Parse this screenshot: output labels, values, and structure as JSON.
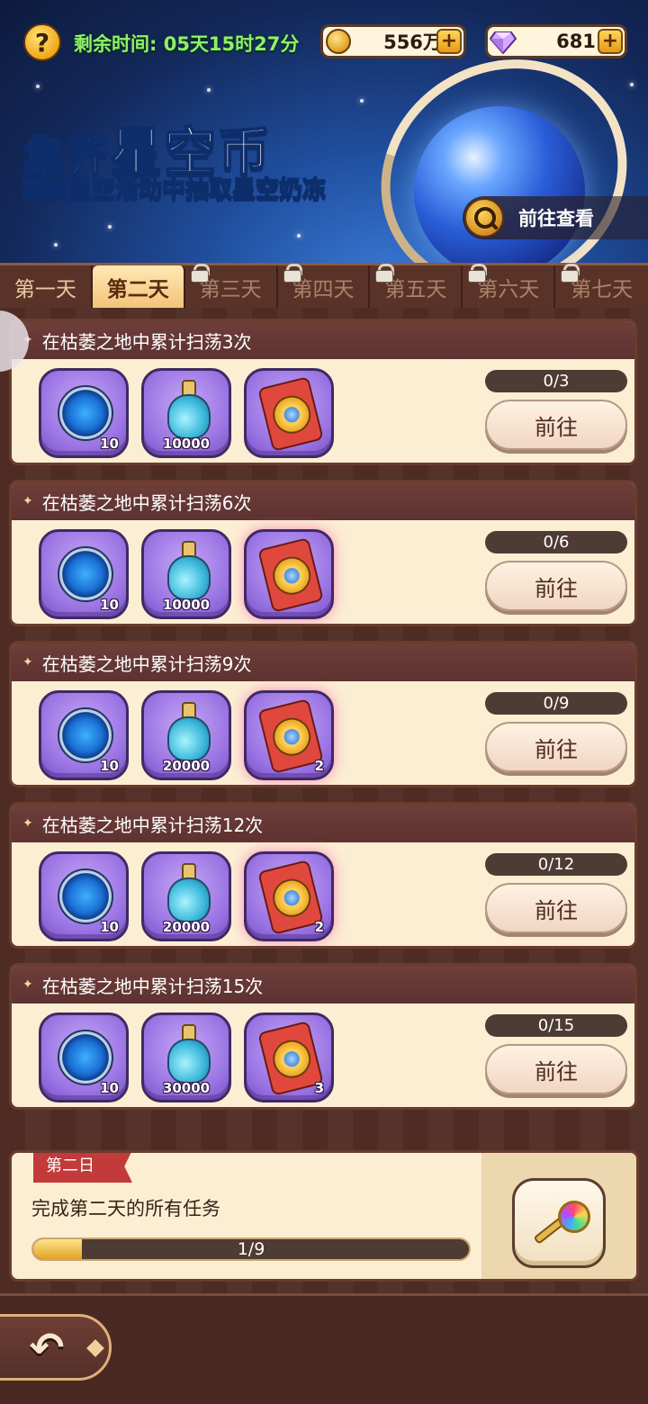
{
  "header": {
    "help_symbol": "?",
    "timer": "剩余时间: 05天15时27分",
    "gold": {
      "value": "556万",
      "icon": "gold-coin-icon"
    },
    "gems": {
      "value": "681",
      "icon": "diamond-icon"
    },
    "plus": "+"
  },
  "banner": {
    "title_prefix": "集齐",
    "title_main": "星空币",
    "subtitle_prefix": "寒夜星空活动中抽取",
    "subtitle_highlight": "星空奶冻",
    "view_button": "前往查看"
  },
  "tabs": [
    {
      "label": "第一天",
      "locked": false
    },
    {
      "label": "第二天",
      "locked": false,
      "active": true
    },
    {
      "label": "第三天",
      "locked": true
    },
    {
      "label": "第四天",
      "locked": true
    },
    {
      "label": "第五天",
      "locked": true
    },
    {
      "label": "第六天",
      "locked": true
    },
    {
      "label": "第七天",
      "locked": true
    }
  ],
  "tasks": [
    {
      "title": "在枯萎之地中累计扫荡3次",
      "progress": "0/3",
      "button": "前往",
      "rewards": [
        {
          "type": "star-coin",
          "qty": "10"
        },
        {
          "type": "potion",
          "qty": "10000"
        },
        {
          "type": "ticket",
          "qty": ""
        }
      ]
    },
    {
      "title": "在枯萎之地中累计扫荡6次",
      "progress": "0/6",
      "button": "前往",
      "rewards": [
        {
          "type": "star-coin",
          "qty": "10"
        },
        {
          "type": "potion",
          "qty": "10000"
        },
        {
          "type": "ticket",
          "qty": ""
        }
      ]
    },
    {
      "title": "在枯萎之地中累计扫荡9次",
      "progress": "0/9",
      "button": "前往",
      "rewards": [
        {
          "type": "star-coin",
          "qty": "10"
        },
        {
          "type": "potion",
          "qty": "20000"
        },
        {
          "type": "ticket",
          "qty": "2"
        }
      ]
    },
    {
      "title": "在枯萎之地中累计扫荡12次",
      "progress": "0/12",
      "button": "前往",
      "rewards": [
        {
          "type": "star-coin",
          "qty": "10"
        },
        {
          "type": "potion",
          "qty": "20000"
        },
        {
          "type": "ticket",
          "qty": "2"
        }
      ]
    },
    {
      "title": "在枯萎之地中累计扫荡15次",
      "progress": "0/15",
      "button": "前往",
      "rewards": [
        {
          "type": "star-coin",
          "qty": "10"
        },
        {
          "type": "potion",
          "qty": "30000"
        },
        {
          "type": "ticket",
          "qty": "3"
        }
      ]
    }
  ],
  "day_summary": {
    "ribbon": "第二日",
    "description": "完成第二天的所有任务",
    "progress_text": "1/9",
    "progress_fraction": 0.111,
    "reward_icon": "rainbow-key-icon"
  },
  "footer": {
    "back_icon": "back-arrow-icon"
  }
}
